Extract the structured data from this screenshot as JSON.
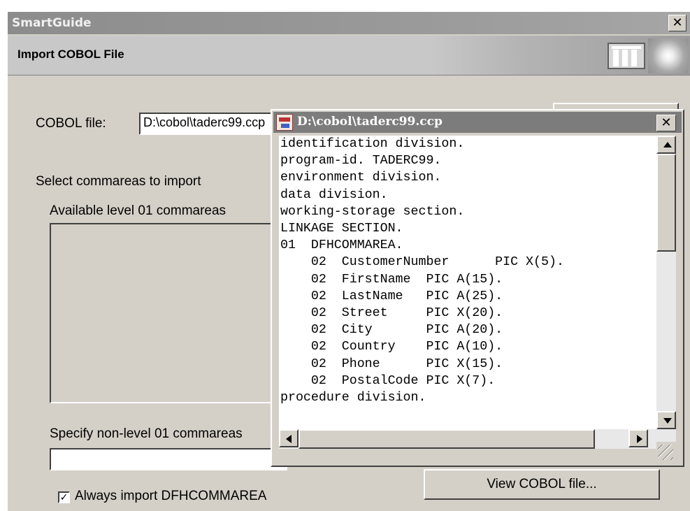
{
  "window": {
    "title": "SmartGuide",
    "header_title": "Import COBOL File",
    "close_glyph": "✕"
  },
  "form": {
    "cobol_file_label": "COBOL file:",
    "cobol_file_value": "D:\\cobol\\taderc99.ccp",
    "select_commareas_label": "Select commareas to import",
    "available_label": "Available level 01 commareas",
    "specify_label": "Specify non-level 01 commareas",
    "specify_value": "",
    "always_import_label": "Always import DFHCOMMAREA",
    "always_import_checked": true,
    "view_button_label": "View COBOL file..."
  },
  "viewer": {
    "title": "D:\\cobol\\taderc99.ccp",
    "close_glyph": "✕",
    "lines": [
      "identification division.",
      "program-id. TADERC99.",
      "environment division.",
      "data division.",
      "working-storage section.",
      "LINKAGE SECTION.",
      "01  DFHCOMMAREA.",
      "    02  CustomerNumber      PIC X(5).",
      "    02  FirstName  PIC A(15).",
      "    02  LastName   PIC A(25).",
      "    02  Street     PIC X(20).",
      "    02  City       PIC A(20).",
      "    02  Country    PIC A(10).",
      "    02  Phone      PIC X(15).",
      "    02  PostalCode PIC X(7).",
      "procedure division."
    ]
  },
  "colors": {
    "titlebar_gray": "#8c8c8c",
    "viewer_titlebar": "#7c7c7c",
    "dialog_face": "#d4d0c8"
  },
  "icons": {
    "window_close": "close-icon",
    "viewer_app": "ccp-file-icon",
    "header_logo": "smartguide-logo-icon"
  }
}
